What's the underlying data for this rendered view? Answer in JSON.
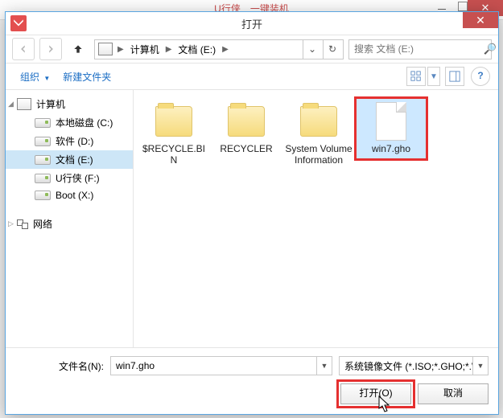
{
  "background_app": {
    "title_partial": "U行侠　一键装机"
  },
  "dialog": {
    "title": "打开",
    "breadcrumb": {
      "root": "计算机",
      "location": "文档 (E:)"
    },
    "search_placeholder": "搜索 文档 (E:)",
    "toolbar": {
      "organize": "组织",
      "new_folder": "新建文件夹"
    },
    "nav_pane": {
      "computer": "计算机",
      "drives": [
        {
          "label": "本地磁盘 (C:)"
        },
        {
          "label": "软件 (D:)"
        },
        {
          "label": "文档 (E:)",
          "selected": true
        },
        {
          "label": "U行侠 (F:)"
        },
        {
          "label": "Boot (X:)"
        }
      ],
      "network": "网络"
    },
    "files": [
      {
        "name": "$RECYCLE.BIN",
        "type": "folder"
      },
      {
        "name": "RECYCLER",
        "type": "folder"
      },
      {
        "name": "System Volume Information",
        "type": "folder"
      },
      {
        "name": "win7.gho",
        "type": "file",
        "selected": true,
        "highlighted": true
      }
    ],
    "footer": {
      "filename_label": "文件名(N):",
      "filename_value": "win7.gho",
      "filter_text": "系统镜像文件 (*.ISO;*.GHO;*.W",
      "open_button": "打开(O)",
      "cancel_button": "取消"
    }
  }
}
